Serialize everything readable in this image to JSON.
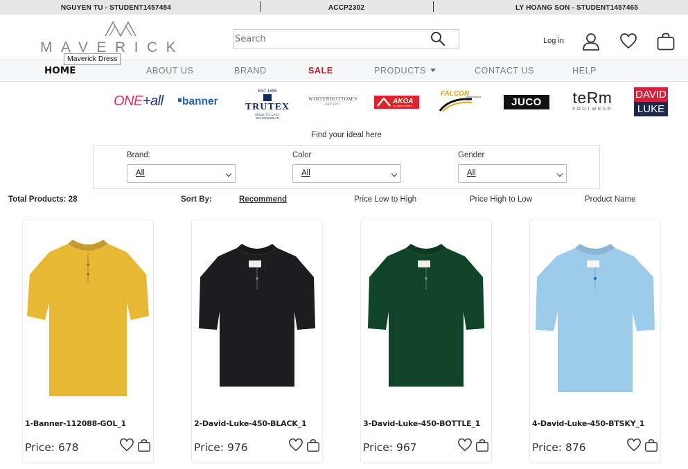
{
  "topbar": {
    "left": "NGUYEN TU - STUDENT1457484",
    "center": "ACCP2302",
    "right": "LY HOANG SON - STUDENT1457465"
  },
  "logo": {
    "text": "MAVERICK",
    "tooltip": "Maverick Dress"
  },
  "search": {
    "placeholder": "Search"
  },
  "header": {
    "login_label": "Log in"
  },
  "nav": {
    "items": [
      "HOME",
      "ABOUT US",
      "BRAND",
      "SALE",
      "PRODUCTS",
      "CONTACT US",
      "HELP"
    ]
  },
  "brands": [
    {
      "name": "ONE+all",
      "part1": "ONE",
      "part2": "+all"
    },
    {
      "name": "banner"
    },
    {
      "name": "TRUTEX",
      "small": "MADE TO LAST SCHOOLWEAR",
      "est": "EST 1895"
    },
    {
      "name": "WINTERBOTTOM'S",
      "small": "EST. 1977"
    },
    {
      "name": "AKOA",
      "small": "ALL ABOUT SPORT"
    },
    {
      "name": "FALCON",
      "small": "SPORTSWEAR LTD"
    },
    {
      "name": "JUCO"
    },
    {
      "name": "teRm",
      "small": "FOOTWEAR"
    },
    {
      "name": "DAVID LUKE",
      "line1": "DAVID",
      "line2": "LUKE"
    }
  ],
  "filters": {
    "heading": "Find your ideal here",
    "groups": [
      {
        "label": "Brand:",
        "value": "All"
      },
      {
        "label": "Color",
        "value": "All"
      },
      {
        "label": "Gender",
        "value": "All"
      }
    ]
  },
  "sort": {
    "total": "Total Products: 28",
    "label": "Sort By:",
    "options": [
      "Recommend",
      "Price Low to High",
      "Price High to Low",
      "Product Name"
    ]
  },
  "products": [
    {
      "name": "1-Banner-112088-GOL_1",
      "price": "Price: 678",
      "color": "#e8b733"
    },
    {
      "name": "2-David-Luke-450-BLACK_1",
      "price": "Price: 976",
      "color": "#1d1d1f"
    },
    {
      "name": "3-David-Luke-450-BOTTLE_1",
      "price": "Price: 967",
      "color": "#0f4428"
    },
    {
      "name": "4-David-Luke-450-BTSKY_1",
      "price": "Price: 876",
      "color": "#9ccbeb"
    }
  ],
  "colors": {
    "sale": "#c21c2a",
    "logo": "#8a7e93",
    "nav_bg": "#f4f6f8"
  }
}
